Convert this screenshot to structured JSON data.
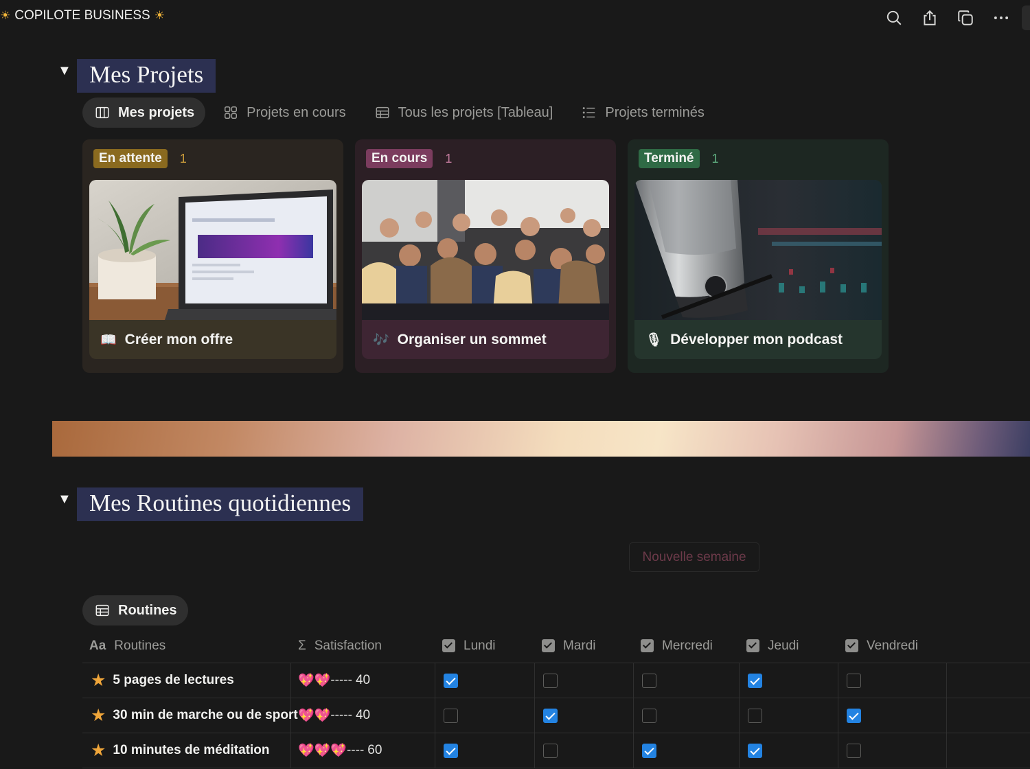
{
  "brand": {
    "title": "COPILOTE BUSINESS",
    "sun_icon": "☀"
  },
  "toolbar": {
    "icons": [
      "search-icon",
      "share-icon",
      "duplicate-icon",
      "more-icon"
    ]
  },
  "projects": {
    "heading": "Mes Projets",
    "tabs": [
      {
        "label": "Mes projets",
        "icon": "board-icon",
        "active": true
      },
      {
        "label": "Projets en cours",
        "icon": "gallery-icon",
        "active": false
      },
      {
        "label": "Tous les projets [Tableau]",
        "icon": "table-icon",
        "active": false
      },
      {
        "label": "Projets terminés",
        "icon": "list-icon",
        "active": false
      }
    ],
    "columns": [
      {
        "status": "En attente",
        "count": "1",
        "colors": {
          "column": "#2a2520",
          "badge": "#8a6a1f",
          "count": "#c89a3a",
          "card": "#3a3426"
        },
        "card": {
          "emoji": "📖",
          "title": "Créer mon offre",
          "cover": "laptop-plant-photo"
        }
      },
      {
        "status": "En cours",
        "count": "1",
        "colors": {
          "column": "#2c1f25",
          "badge": "#7b3c5e",
          "count": "#c27a9c",
          "card": "#3e2533"
        },
        "card": {
          "emoji": "🎶",
          "title": "Organiser un sommet",
          "cover": "audience-photo"
        }
      },
      {
        "status": "Terminé",
        "count": "1",
        "colors": {
          "column": "#1d2722",
          "badge": "#2f6a45",
          "count": "#5fae80",
          "card": "#25352d"
        },
        "card": {
          "emoji": "🎙",
          "title": "Développer mon podcast",
          "cover": "microphone-photo"
        }
      }
    ]
  },
  "routines": {
    "heading": "Mes Routines quotidiennes",
    "new_week_button": "Nouvelle semaine",
    "view_tab": "Routines",
    "columns": {
      "name": {
        "icon": "Aa",
        "label": "Routines"
      },
      "satisfaction": {
        "icon": "Σ",
        "label": "Satisfaction"
      },
      "days": [
        "Lundi",
        "Mardi",
        "Mercredi",
        "Jeudi",
        "Vendredi"
      ]
    },
    "rows": [
      {
        "name": "5 pages de lectures",
        "hearts": "💖💖",
        "bar": "-----",
        "score": "40",
        "checks": [
          true,
          false,
          false,
          true,
          false
        ]
      },
      {
        "name": "30 min de marche ou de sport",
        "hearts": "💖💖",
        "bar": "-----",
        "score": "40",
        "checks": [
          false,
          true,
          false,
          false,
          true
        ]
      },
      {
        "name": "10 minutes de méditation",
        "hearts": "💖💖💖",
        "bar": "----",
        "score": "60",
        "checks": [
          true,
          false,
          true,
          true,
          false
        ]
      }
    ]
  }
}
